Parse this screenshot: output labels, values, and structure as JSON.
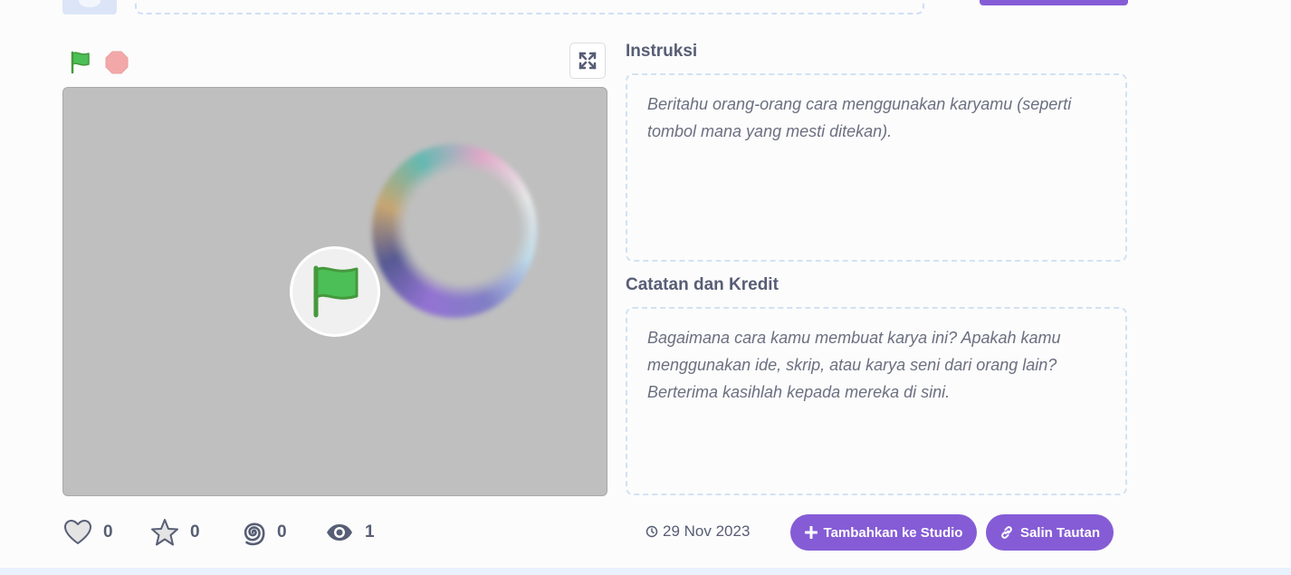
{
  "colors": {
    "accent": "#855cd6",
    "text": "#575e75",
    "stage_background": "#bfbfbf",
    "green_flag": "#4cbf56",
    "stop": "#ec5959"
  },
  "header": {
    "avatar_icon": "user-avatar",
    "title_input_value": ""
  },
  "player": {
    "green_flag_icon": "green-flag",
    "stop_icon": "stop-sign",
    "fullscreen_icon": "fullscreen-expand",
    "overlay_icon": "green-flag"
  },
  "instructions": {
    "title": "Instruksi",
    "placeholder": "Beritahu orang-orang cara menggunakan karyamu (seperti tombol mana yang mesti ditekan)."
  },
  "notes": {
    "title": "Catatan dan Kredit",
    "placeholder": "Bagaimana cara kamu membuat karya ini? Apakah kamu menggunakan ide, skrip, atau karya seni dari orang lain? Berterima kasihlah kepada mereka di sini."
  },
  "stats": {
    "loves": "0",
    "favorites": "0",
    "remixes": "0",
    "views": "1"
  },
  "meta": {
    "date": "29 Nov 2023"
  },
  "actions": {
    "add_to_studio": "Tambahkan ke Studio",
    "copy_link": "Salin Tautan"
  }
}
